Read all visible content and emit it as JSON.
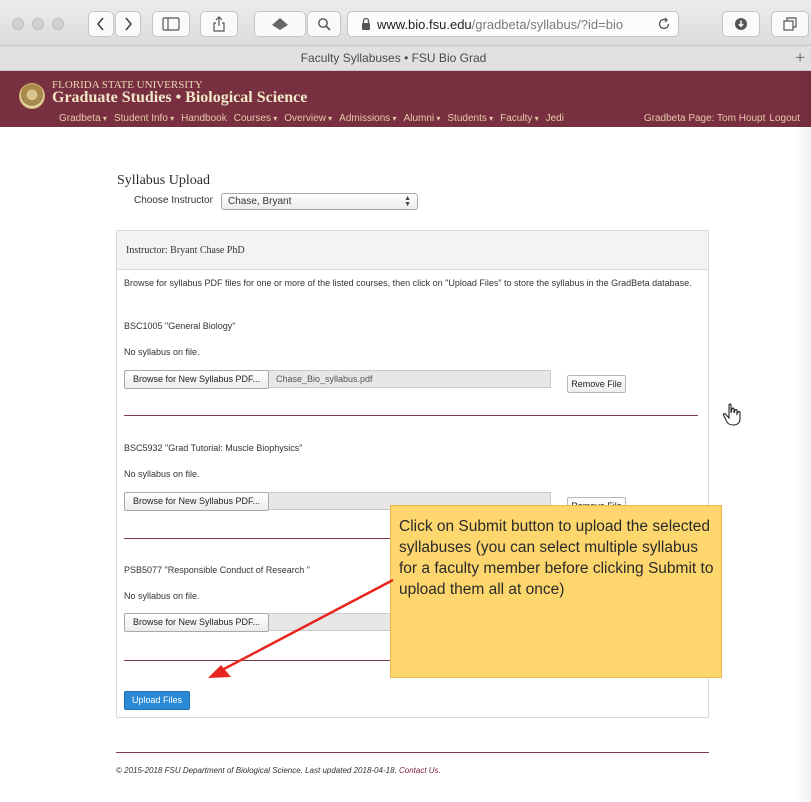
{
  "browser": {
    "url_host": "www.bio.fsu.edu",
    "url_path": "/gradbeta/syllabus/?id=bio",
    "tab_title": "Faculty Syllabuses • FSU Bio Grad",
    "new_tab": "+"
  },
  "site": {
    "university": "FLORIDA STATE UNIVERSITY",
    "department": "Graduate Studies • Biological Science",
    "nav": [
      "Gradbeta",
      "Student Info",
      "Handbook",
      "Courses",
      "Overview",
      "Admissions",
      "Alumni",
      "Students",
      "Faculty",
      "Jedi"
    ],
    "user_label": "Gradbeta Page: Tom Houpt",
    "logout": "Logout",
    "header_color": "#782f40"
  },
  "page": {
    "title": "Syllabus Upload",
    "choose_label": "Choose Instructor",
    "instructor_selected": "Chase, Bryant"
  },
  "panel": {
    "heading": "Instructor: Bryant Chase PhD",
    "instructions": "Browse for syllabus PDF files for one or more of the listed courses, then click on \"Upload Files\" to store the syllabus in the GradBeta database.",
    "browse_label": "Browse for New Syllabus PDF...",
    "remove_label": "Remove File",
    "courses": [
      {
        "title": "BSC1005 \"General Biology\"",
        "status": "No syllabus on file.",
        "file": "Chase_Bio_syllabus.pdf"
      },
      {
        "title": "BSC5932 \"Grad Tutorial: Muscle Biophysics\"",
        "status": "No syllabus on file.",
        "file": ""
      },
      {
        "title": "PSB5077 \"Responsible Conduct of Research \"",
        "status": "No syllabus on file.",
        "file": ""
      }
    ],
    "upload_label": "Upload Files"
  },
  "footer": {
    "text": "© 2015-2018 FSU Department of Biological Science. Last updated 2018-04-18.",
    "contact": "Contact Us."
  },
  "callout": {
    "text": "Click on Submit button to upload the selected syllabuses (you can select multiple syllabus for a faculty member before clicking Submit to upload them all at once)",
    "color": "#fdd66d"
  }
}
